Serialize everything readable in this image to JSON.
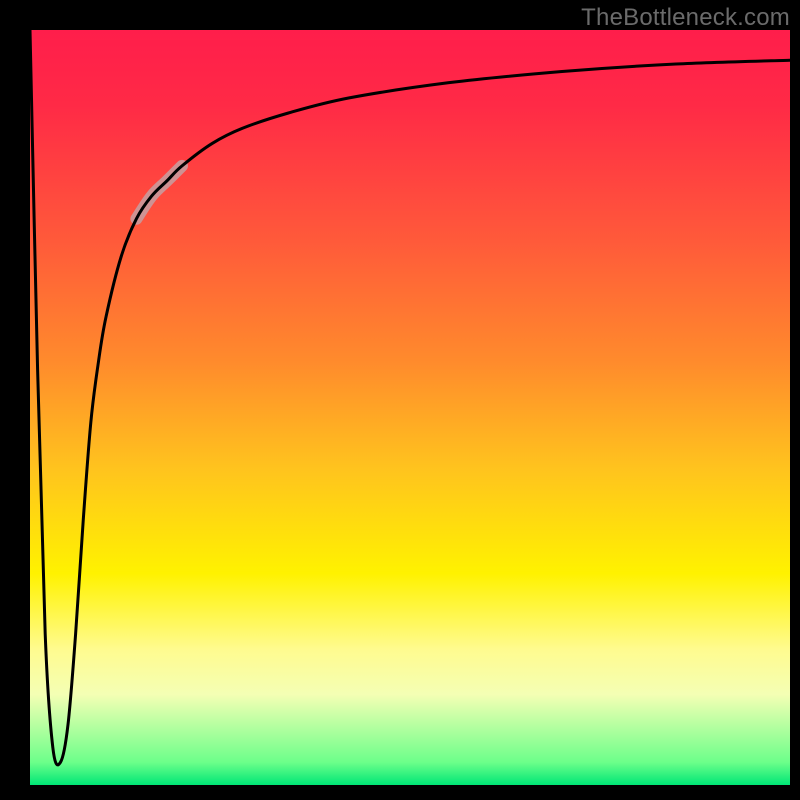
{
  "watermark": {
    "text": "TheBottleneck.com"
  },
  "chart_data": {
    "type": "line",
    "title": "",
    "xlabel": "",
    "ylabel": "",
    "xlim": [
      0,
      100
    ],
    "ylim": [
      0,
      100
    ],
    "background_gradient": {
      "orientation": "vertical",
      "stops": [
        {
          "pos": 0.0,
          "color": "#ff1e4b"
        },
        {
          "pos": 0.28,
          "color": "#ff5a3a"
        },
        {
          "pos": 0.58,
          "color": "#ffc31e"
        },
        {
          "pos": 0.72,
          "color": "#fff200"
        },
        {
          "pos": 0.88,
          "color": "#f4ffb4"
        },
        {
          "pos": 1.0,
          "color": "#00e676"
        }
      ]
    },
    "series": [
      {
        "name": "bottleneck-curve",
        "color": "#000000",
        "x": [
          0,
          1,
          2,
          3,
          4,
          5,
          6,
          7,
          8,
          9,
          10,
          12,
          14,
          16,
          18,
          20,
          24,
          28,
          34,
          42,
          55,
          70,
          85,
          100
        ],
        "y": [
          100,
          55,
          20,
          5,
          3,
          8,
          20,
          35,
          48,
          56,
          62,
          70,
          75,
          78,
          80,
          82,
          85,
          87,
          89,
          91,
          93,
          94.5,
          95.5,
          96
        ]
      }
    ],
    "highlight_segment": {
      "of_series": "bottleneck-curve",
      "x_from": 14,
      "x_to": 20,
      "color": "#c99a9c",
      "width": 12
    }
  }
}
